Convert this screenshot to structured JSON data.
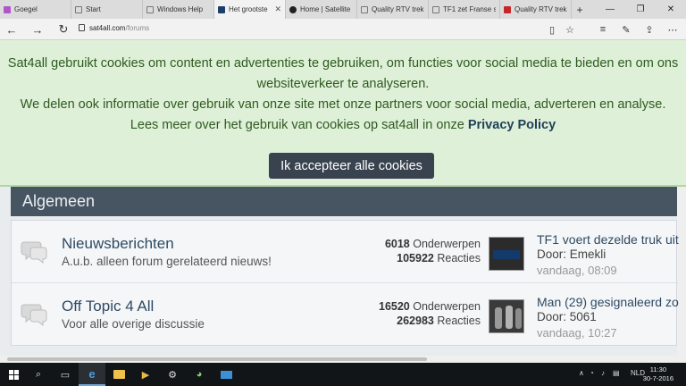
{
  "tabs": [
    {
      "title": "Goegel",
      "color": "#b056c8"
    },
    {
      "title": "Start",
      "color": "#777777"
    },
    {
      "title": "Windows Help",
      "color": "#777777"
    },
    {
      "title": "Het grootste",
      "color": "#1d3e6b",
      "active": true
    },
    {
      "title": "Home | Satellite",
      "color": "#222222"
    },
    {
      "title": "Quality RTV trek",
      "color": "#777777"
    },
    {
      "title": "TF1 zet Franse s",
      "color": "#777777"
    },
    {
      "title": "Quality RTV trek",
      "color": "#c62828"
    }
  ],
  "address": {
    "domain": "sat4all.com",
    "path": "/forums"
  },
  "cookie": {
    "line1": "Sat4all gebruikt cookies om content en advertenties te gebruiken, om functies voor social media te bieden en om ons",
    "line2": "websiteverkeer te analyseren.",
    "line3": "We delen ook informatie over gebruik van onze site met onze partners voor social media, adverteren en analyse.",
    "line4_prefix": "Lees meer over het gebruik van cookies op sat4all in onze ",
    "line4_link": "Privacy Policy",
    "accept_label": "Ik accepteer alle cookies"
  },
  "section": {
    "title": "Algemeen"
  },
  "forums": [
    {
      "title": "Nieuwsberichten",
      "description": "A.u.b. alleen forum gerelateerd nieuws!",
      "topics_count": "6018",
      "topics_label": "Onderwerpen",
      "replies_count": "105922",
      "replies_label": "Reacties",
      "last_title": "TF1 voert dezelde truk uit",
      "last_by": "Door: Emekli",
      "last_time": "vandaag, 08:09"
    },
    {
      "title": "Off Topic 4 All",
      "description": "Voor alle overige discussie",
      "topics_count": "16520",
      "topics_label": "Onderwerpen",
      "replies_count": "262983",
      "replies_label": "Reacties",
      "last_title": "Man (29) gesignaleerd zo",
      "last_by": "Door: 5061",
      "last_time": "vandaag, 10:27"
    }
  ],
  "taskbar": {
    "language": "NLD",
    "time": "11:30",
    "date": "30-7-2016"
  }
}
